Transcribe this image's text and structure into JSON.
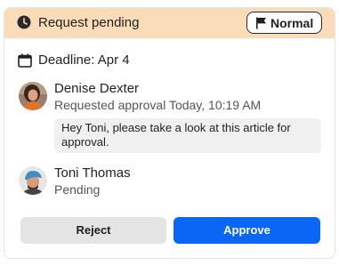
{
  "header": {
    "status": "Request pending",
    "status_icon": "clock-icon",
    "priority_label": "Normal",
    "priority_icon": "flag-icon",
    "background": "#fbdcb8"
  },
  "deadline": {
    "text": "Deadline: Apr 4",
    "icon": "calendar-icon"
  },
  "requester": {
    "name": "Denise Dexter",
    "action": "Requested approval Today, 10:19 AM",
    "comment": "Hey Toni, please take a look at this article for approval."
  },
  "approver": {
    "name": "Toni Thomas",
    "status": "Pending"
  },
  "actions": {
    "reject_label": "Reject",
    "approve_label": "Approve",
    "approve_color": "#0b66f5"
  }
}
